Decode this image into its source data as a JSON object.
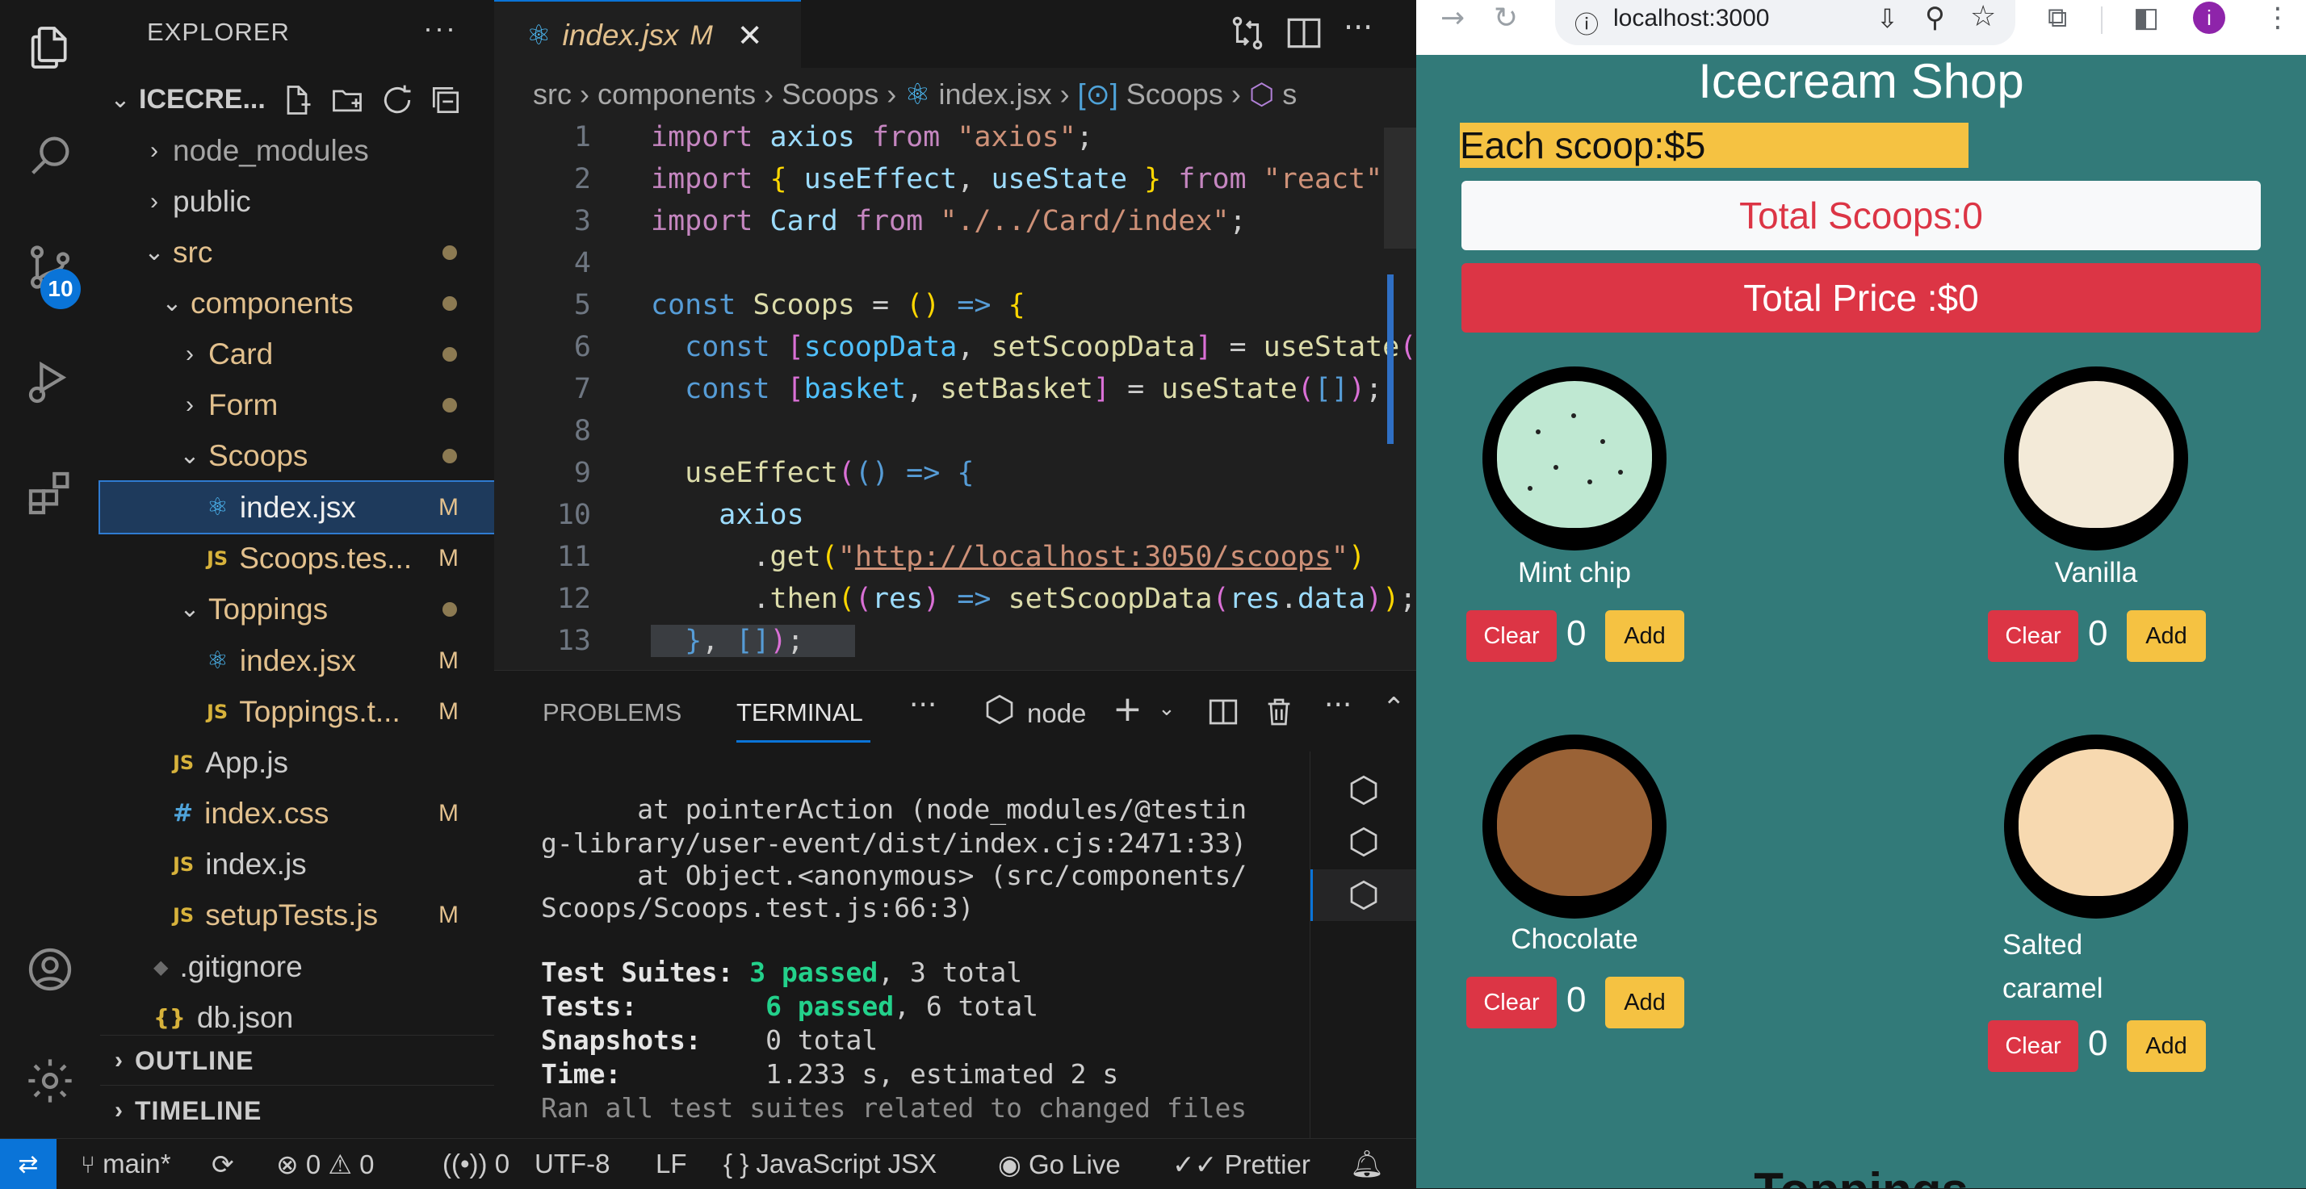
{
  "sidebar": {
    "title": "EXPLORER",
    "more": "···",
    "root": "ICECRE...",
    "tree": [
      {
        "label": "node_modules",
        "chev": "›",
        "icon": "",
        "status": ""
      },
      {
        "label": "public",
        "chev": "›",
        "icon": "",
        "status": ""
      },
      {
        "label": "src",
        "chev": "⌄",
        "icon": "",
        "status": "dot"
      },
      {
        "label": "components",
        "chev": "⌄",
        "icon": "",
        "status": "dot"
      },
      {
        "label": "Card",
        "chev": "›",
        "icon": "",
        "status": "dot"
      },
      {
        "label": "Form",
        "chev": "›",
        "icon": "",
        "status": "dot"
      },
      {
        "label": "Scoops",
        "chev": "⌄",
        "icon": "",
        "status": "dot"
      },
      {
        "label": "index.jsx",
        "chev": "",
        "icon": "⚛",
        "status": "M"
      },
      {
        "label": "Scoops.tes...",
        "chev": "",
        "icon": "JS",
        "status": "M"
      },
      {
        "label": "Toppings",
        "chev": "⌄",
        "icon": "",
        "status": "dot"
      },
      {
        "label": "index.jsx",
        "chev": "",
        "icon": "⚛",
        "status": "M"
      },
      {
        "label": "Toppings.t...",
        "chev": "",
        "icon": "JS",
        "status": "M"
      },
      {
        "label": "App.js",
        "chev": "",
        "icon": "JS",
        "status": ""
      },
      {
        "label": "index.css",
        "chev": "",
        "icon": "#",
        "status": "M"
      },
      {
        "label": "index.js",
        "chev": "",
        "icon": "JS",
        "status": ""
      },
      {
        "label": "setupTests.js",
        "chev": "",
        "icon": "JS",
        "status": "M"
      },
      {
        "label": ".gitignore",
        "chev": "",
        "icon": "◆",
        "status": ""
      },
      {
        "label": "db.json",
        "chev": "",
        "icon": "{}",
        "status": ""
      }
    ],
    "outline": "OUTLINE",
    "timeline": "TIMELINE",
    "scm_badge": "10"
  },
  "editor": {
    "tab_label": "index.jsx",
    "tab_status": "M",
    "breadcrumbs": [
      "src",
      "components",
      "Scoops",
      "index.jsx",
      "Scoops",
      "s"
    ],
    "line_numbers": [
      "1",
      "2",
      "3",
      "4",
      "5",
      "6",
      "7",
      "8",
      "9",
      "10",
      "11",
      "12",
      "13"
    ]
  },
  "panel": {
    "tabs": [
      "PROBLEMS",
      "TERMINAL"
    ],
    "shell": "node",
    "terminal_lines": [
      "      at pointerAction (node_modules/@testin",
      "g-library/user-event/dist/index.cjs:2471:33)",
      "      at Object.<anonymous> (src/components/",
      "Scoops/Scoops.test.js:66:3)",
      "",
      "",
      "",
      "Ran all test suites related to changed files"
    ],
    "summary": {
      "suites_label": "Test Suites:",
      "suites_passed": "3 passed",
      "suites_total": ", 3 total",
      "tests_label": "Tests:",
      "tests_passed": "6 passed",
      "tests_total": ", 6 total",
      "snap_label": "Snapshots:",
      "snap_value": "0 total",
      "time_label": "Time:",
      "time_value": "1.233 s, estimated 2 s"
    }
  },
  "status": {
    "branch": "main*",
    "errors": "0",
    "warnings": "0",
    "ports": "0",
    "encoding": "UTF-8",
    "eol": "LF",
    "language": "JavaScript JSX",
    "golive": "Go Live",
    "prettier": "Prettier"
  },
  "browser": {
    "url": "localhost:3000",
    "profile_initial": "i",
    "shop_title": "Icecream Shop",
    "each_scoop": "Each scoop:$5",
    "total_scoops": "Total Scoops:0",
    "total_price": "Total Price :$0",
    "clear_label": "Clear",
    "add_label": "Add",
    "scoops": [
      {
        "name": "Mint chip",
        "count": "0",
        "color": "#bfe8d2"
      },
      {
        "name": "Vanilla",
        "count": "0",
        "color": "#f3ead8"
      },
      {
        "name": "Chocolate",
        "count": "0",
        "color": "#9a6236"
      },
      {
        "name": "Salted caramel",
        "count": "0",
        "color": "#f7d9b0"
      }
    ],
    "toppings_peek": "Toppings"
  },
  "colors": {
    "accent": "#0a74d8",
    "modified": "#e2c08d",
    "shop_bg": "#327a79",
    "danger": "#dc3545",
    "warning": "#f5c242"
  }
}
